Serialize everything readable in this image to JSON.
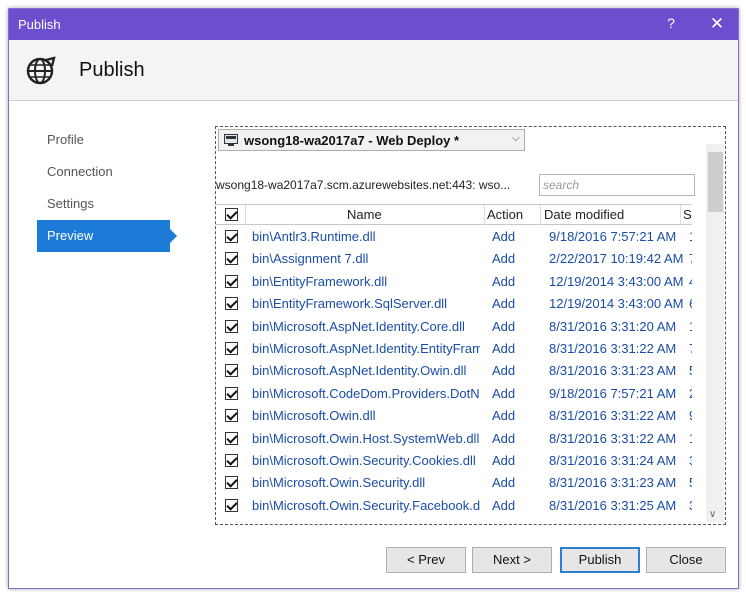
{
  "window": {
    "title": "Publish",
    "help_label": "?",
    "close_label": "✕"
  },
  "header": {
    "title": "Publish",
    "icon": "globe-publish-icon"
  },
  "nav": {
    "items": [
      {
        "label": "Profile",
        "active": false
      },
      {
        "label": "Connection",
        "active": false
      },
      {
        "label": "Settings",
        "active": false
      },
      {
        "label": "Preview",
        "active": true
      }
    ]
  },
  "profile": {
    "selected": "wsong18-wa2017a7 - Web Deploy *"
  },
  "server": {
    "text": "wsong18-wa2017a7.scm.azurewebsites.net:443: wso..."
  },
  "search": {
    "placeholder": "search",
    "value": ""
  },
  "grid": {
    "columns": [
      "Name",
      "Action",
      "Date modified",
      "Si"
    ],
    "rows": [
      {
        "name": "bin\\Antlr3.Runtime.dll",
        "action": "Add",
        "date": "9/18/2016 7:57:21 AM",
        "size": "1"
      },
      {
        "name": "bin\\Assignment 7.dll",
        "action": "Add",
        "date": "2/22/2017 10:19:42 AM",
        "size": "7"
      },
      {
        "name": "bin\\EntityFramework.dll",
        "action": "Add",
        "date": "12/19/2014 3:43:00 AM",
        "size": "4"
      },
      {
        "name": "bin\\EntityFramework.SqlServer.dll",
        "action": "Add",
        "date": "12/19/2014 3:43:00 AM",
        "size": "6"
      },
      {
        "name": "bin\\Microsoft.AspNet.Identity.Core.dll",
        "action": "Add",
        "date": "8/31/2016 3:31:20 AM",
        "size": "1"
      },
      {
        "name": "bin\\Microsoft.AspNet.Identity.EntityFrame",
        "action": "Add",
        "date": "8/31/2016 3:31:22 AM",
        "size": "7"
      },
      {
        "name": "bin\\Microsoft.AspNet.Identity.Owin.dll",
        "action": "Add",
        "date": "8/31/2016 3:31:23 AM",
        "size": "5"
      },
      {
        "name": "bin\\Microsoft.CodeDom.Providers.DotNet",
        "action": "Add",
        "date": "9/18/2016 7:57:21 AM",
        "size": "2"
      },
      {
        "name": "bin\\Microsoft.Owin.dll",
        "action": "Add",
        "date": "8/31/2016 3:31:22 AM",
        "size": "9"
      },
      {
        "name": "bin\\Microsoft.Owin.Host.SystemWeb.dll",
        "action": "Add",
        "date": "8/31/2016 3:31:22 AM",
        "size": "1"
      },
      {
        "name": "bin\\Microsoft.Owin.Security.Cookies.dll",
        "action": "Add",
        "date": "8/31/2016 3:31:24 AM",
        "size": "3"
      },
      {
        "name": "bin\\Microsoft.Owin.Security.dll",
        "action": "Add",
        "date": "8/31/2016 3:31:23 AM",
        "size": "5"
      },
      {
        "name": "bin\\Microsoft.Owin.Security.Facebook.dll",
        "action": "Add",
        "date": "8/31/2016 3:31:25 AM",
        "size": "3"
      }
    ]
  },
  "buttons": {
    "prev": "< Prev",
    "next": "Next >",
    "publish": "Publish",
    "close": "Close"
  },
  "colors": {
    "titlebar": "#6b4fcf",
    "accent": "#1c7bd6",
    "link": "#1a4da8"
  }
}
